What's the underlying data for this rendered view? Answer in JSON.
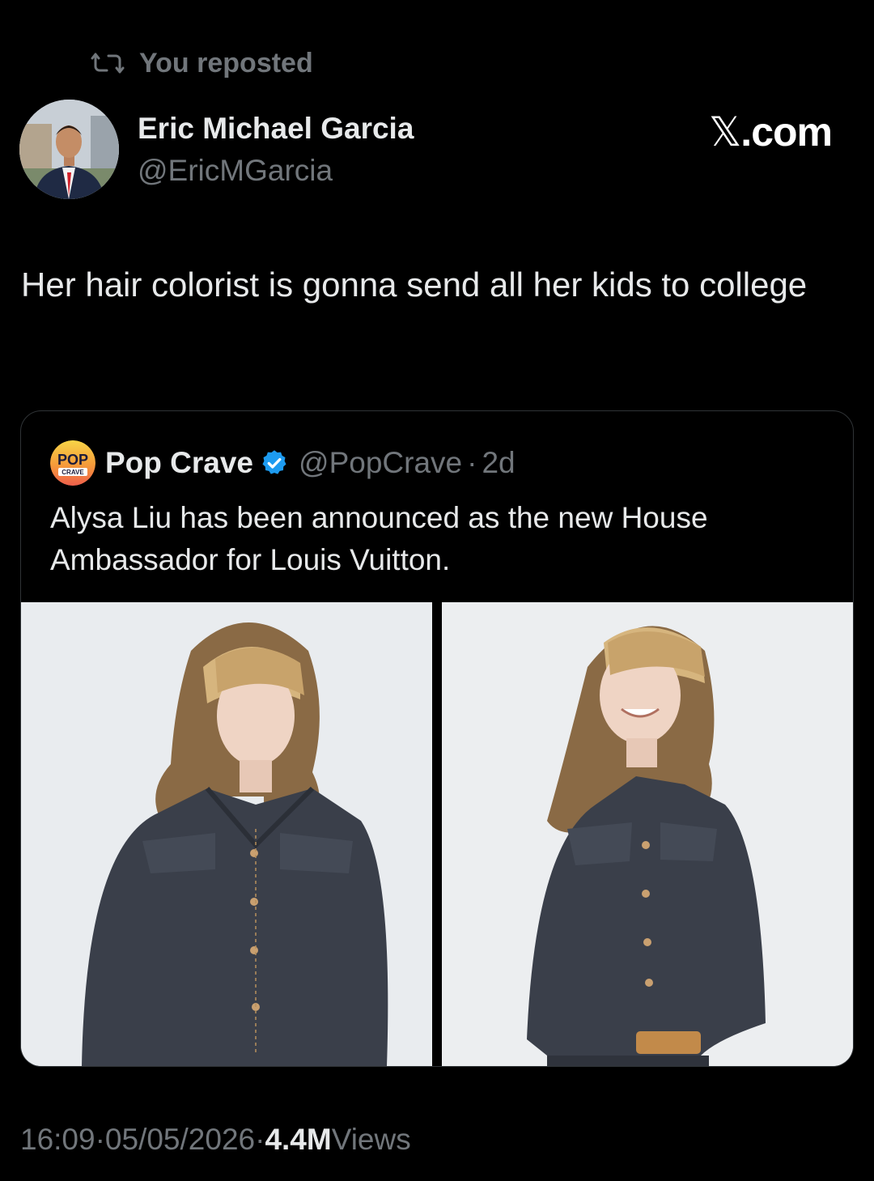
{
  "repost": {
    "label": "You reposted",
    "icon": "repost-icon"
  },
  "author": {
    "name": "Eric Michael Garcia",
    "handle": "@EricMGarcia"
  },
  "brand": {
    "x": "𝕏",
    "suffix": ".com"
  },
  "tweet": {
    "text": "Her hair colorist is gonna send all her kids to college"
  },
  "quote": {
    "account_logo_text": "POP",
    "account_logo_subtext": "CRAVE",
    "name": "Pop Crave",
    "verified": true,
    "handle": "@PopCrave",
    "separator": "·",
    "age": "2d",
    "text": "Alysa Liu has been announced as the new House Ambassador for Louis Vuitton.",
    "media_count": 2
  },
  "footer": {
    "time": "16:09",
    "date": "05/05/2026",
    "separator": "·",
    "views_count": "4.4M",
    "views_label": "Views"
  },
  "colors": {
    "background": "#000000",
    "text": "#e7e9ea",
    "secondary": "#71767b",
    "border": "#2f3336",
    "verified": "#1d9bf0"
  }
}
